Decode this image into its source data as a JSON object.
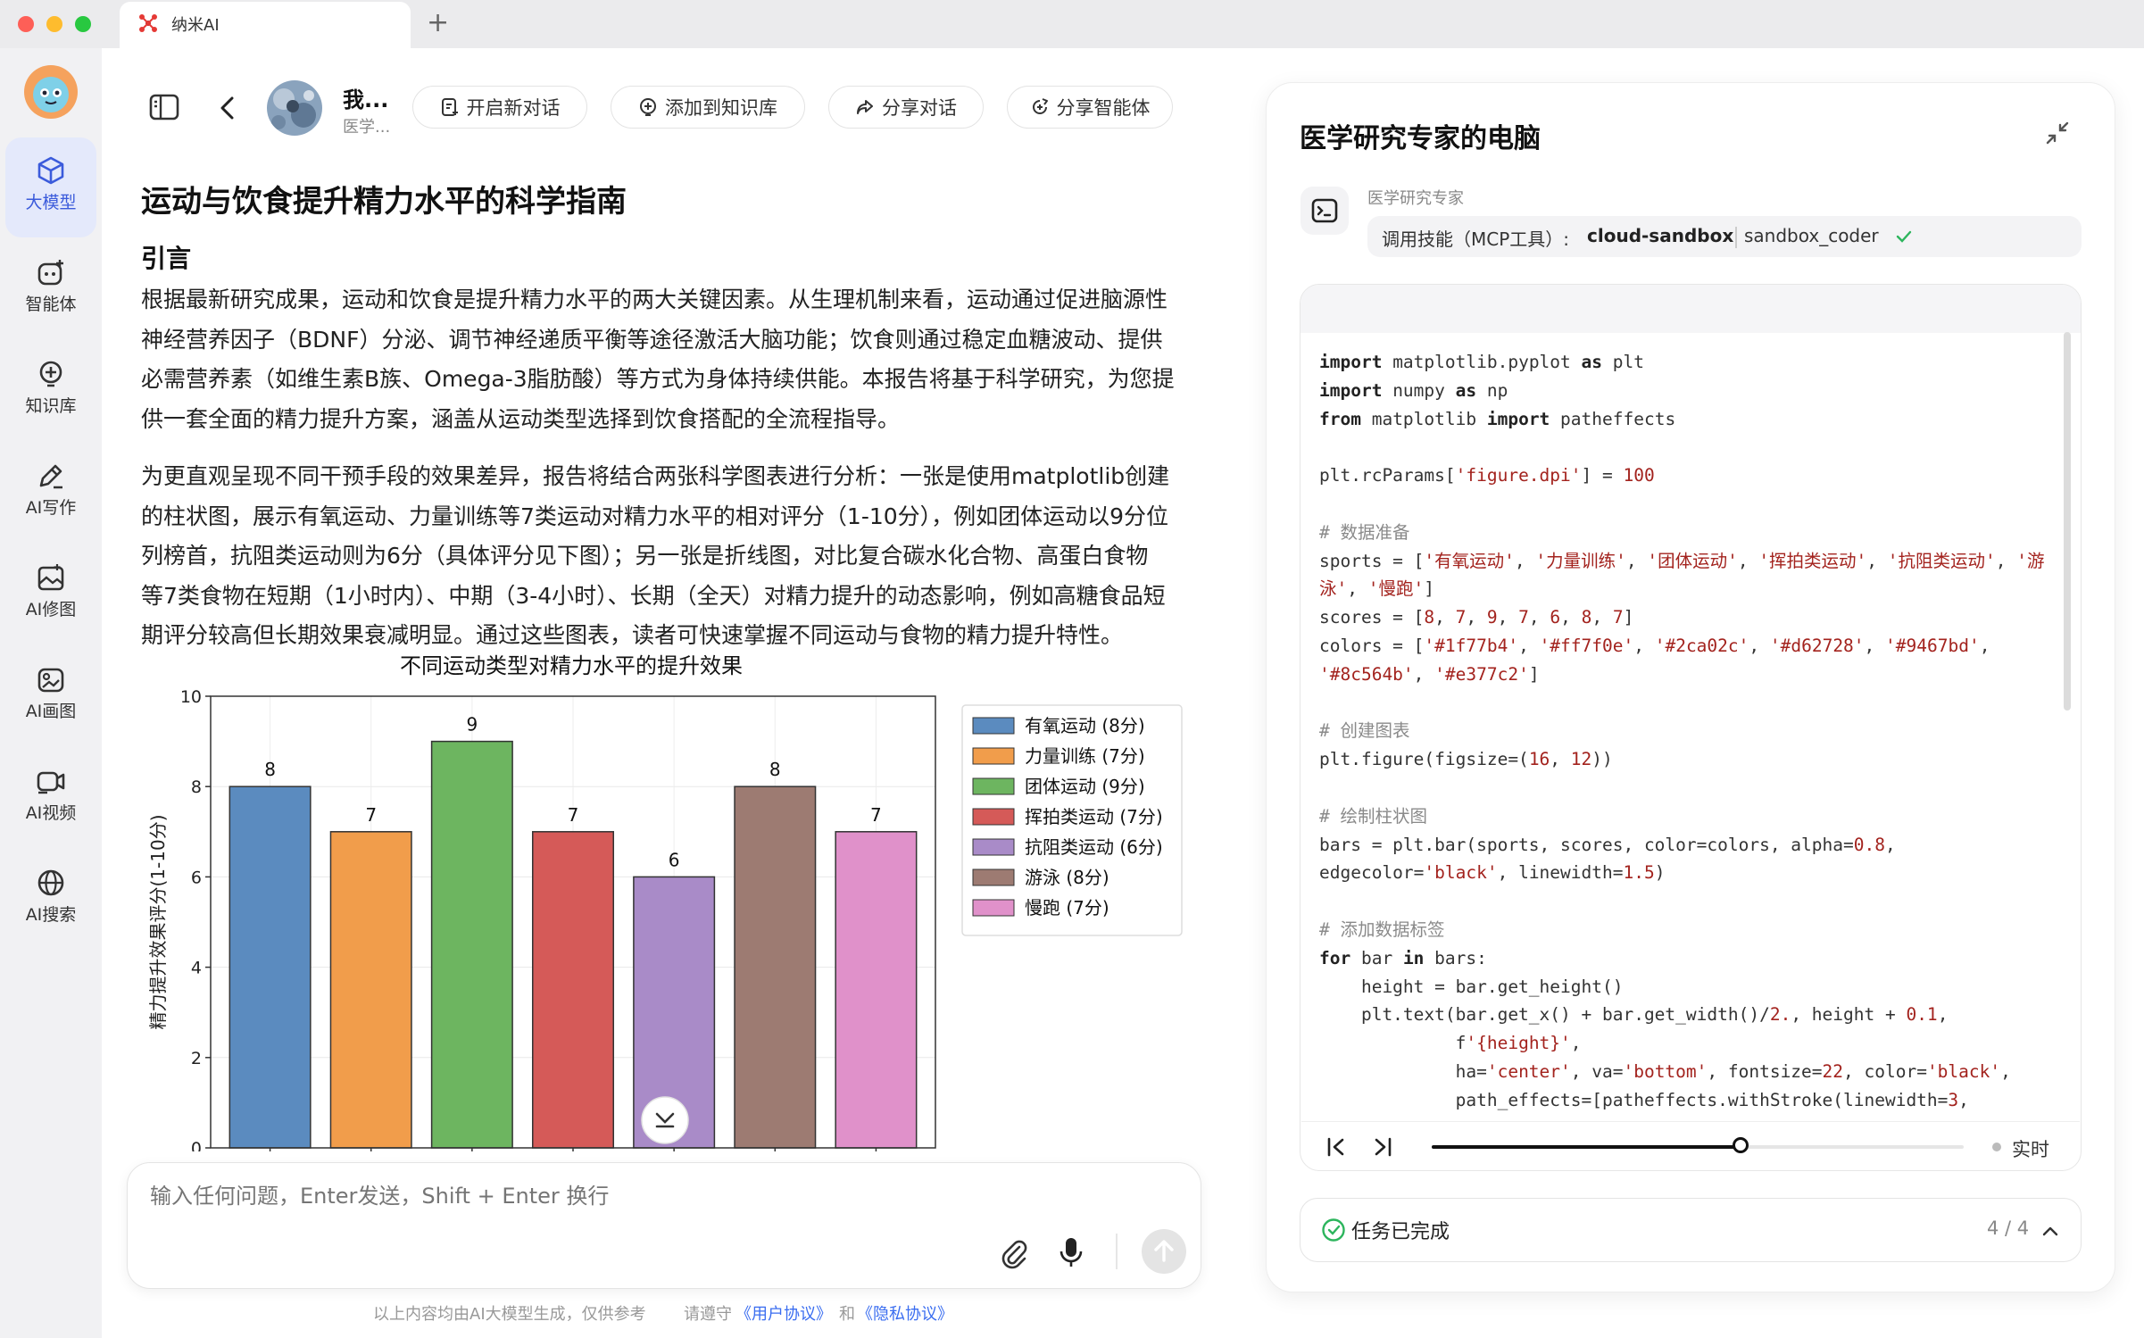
{
  "window": {
    "tab_title": "纳米AI",
    "new_tab_symbol": "+"
  },
  "sidebar": {
    "items": [
      {
        "label": "大模型",
        "icon": "cube-icon",
        "active": true
      },
      {
        "label": "智能体",
        "icon": "agent-icon"
      },
      {
        "label": "知识库",
        "icon": "knowledge-icon"
      },
      {
        "label": "AI写作",
        "icon": "pen-icon"
      },
      {
        "label": "AI修图",
        "icon": "image-edit-icon"
      },
      {
        "label": "AI画图",
        "icon": "paint-icon"
      },
      {
        "label": "AI视频",
        "icon": "video-icon"
      },
      {
        "label": "AI搜索",
        "icon": "globe-icon"
      }
    ]
  },
  "header": {
    "agent_name": "我...",
    "agent_sub": "医学...",
    "buttons": {
      "new_chat": "开启新对话",
      "add_kb": "添加到知识库",
      "share_chat": "分享对话",
      "share_agent": "分享智能体"
    }
  },
  "article": {
    "title": "运动与饮食提升精力水平的科学指南",
    "section": "引言",
    "para1": [
      "根据最新研究成果，运动和饮食是提升精力水平的两大关键因素。从生理机制来看，运动通过促进脑源性",
      "神经营养因子（BDNF）分泌、调节神经递质平衡等途径激活大脑功能；饮食则通过稳定血糖波动、提供",
      "必需营养素（如维生素B族、Omega-3脂肪酸）等方式为身体持续供能。本报告将基于科学研究，为您提",
      "供一套全面的精力提升方案，涵盖从运动类型选择到饮食搭配的全流程指导。"
    ],
    "para2": [
      "为更直观呈现不同干预手段的效果差异，报告将结合两张科学图表进行分析：一张是使用matplotlib创建",
      "的柱状图，展示有氧运动、力量训练等7类运动对精力水平的相对评分（1-10分），例如团体运动以9分位",
      "列榜首，抗阻类运动则为6分（具体评分见下图）；另一张是折线图，对比复合碳水化合物、高蛋白食物",
      "等7类食物在短期（1小时内）、中期（3-4小时）、长期（全天）对精力提升的动态影响，例如高糖食品短",
      "期评分较高但长期效果衰减明显。通过这些图表，读者可快速掌握不同运动与食物的精力提升特性。"
    ]
  },
  "chart_data": {
    "type": "bar",
    "title": "不同运动类型对精力水平的提升效果",
    "ylabel": "精力提升效果评分(1-10分)",
    "xlabel": "",
    "ylim": [
      0,
      10
    ],
    "yticks": [
      "0",
      "2",
      "4",
      "6",
      "8",
      "10"
    ],
    "categories": [
      "有氧运动",
      "力量训练",
      "团体运动",
      "挥拍类运动",
      "抗阻类运动",
      "游泳",
      "慢跑"
    ],
    "values": [
      8,
      7,
      9,
      7,
      6,
      8,
      7
    ],
    "colors": [
      "#5b8bbf",
      "#f19d4b",
      "#6db560",
      "#d55a58",
      "#a98bc8",
      "#9d7b72",
      "#e091ca"
    ],
    "legend": [
      "有氧运动 (8分)",
      "力量训练 (7分)",
      "团体运动 (9分)",
      "挥拍类运动 (7分)",
      "抗阻类运动 (6分)",
      "游泳 (8分)",
      "慢跑 (7分)"
    ],
    "legend_position": "upper-right-outside",
    "grid": true
  },
  "input": {
    "placeholder": "输入任何问题，Enter发送，Shift + Enter 换行"
  },
  "footer": {
    "text": "以上内容均由AI大模型生成，仅供参考",
    "agree": "请遵守",
    "user_agreement": "《用户协议》",
    "and": "和",
    "privacy": "《隐私协议》"
  },
  "panel": {
    "title": "医学研究专家的电脑",
    "tool_owner": "医学研究专家",
    "tool_label": "调用技能（MCP工具）:",
    "tool_name": "cloud-sandbox",
    "tool_sub": "sandbox_coder",
    "live_label": "实时",
    "progress": 0.58,
    "task_status": "任务已完成",
    "task_count": "4 / 4"
  },
  "colors": {
    "accent": "#3b5bdb",
    "success": "#2db55d",
    "link": "#3a6df0"
  }
}
